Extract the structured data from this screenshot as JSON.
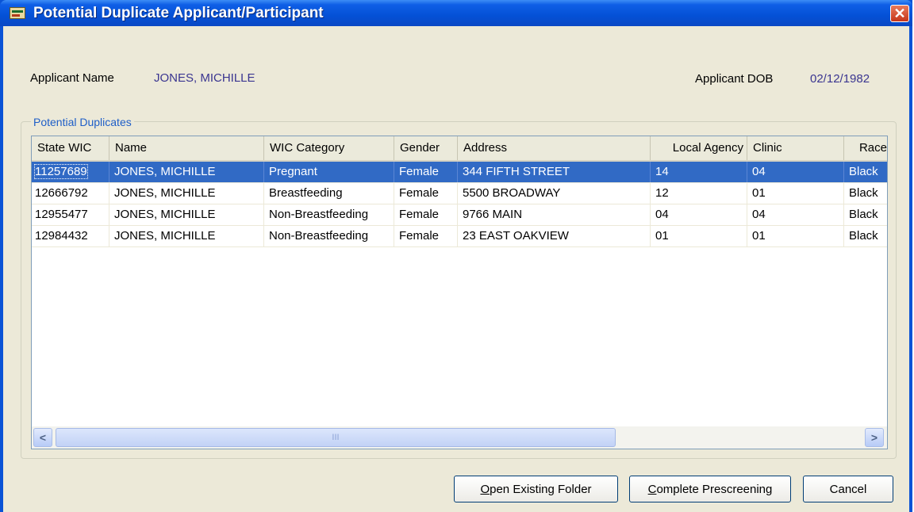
{
  "window": {
    "title": "Potential Duplicate Applicant/Participant",
    "close_glyph": "✕"
  },
  "applicant": {
    "name_label": "Applicant Name",
    "name_value": "JONES, MICHILLE",
    "dob_label": "Applicant DOB",
    "dob_value": "02/12/1982"
  },
  "duplicates": {
    "group_title": "Potential Duplicates",
    "columns": [
      "State WIC",
      "Name",
      "WIC Category",
      "Gender",
      "Address",
      "Local Agency",
      "Clinic",
      "Race"
    ],
    "rows": [
      [
        "11257689",
        "JONES, MICHILLE",
        "Pregnant",
        "Female",
        "344 FIFTH STREET",
        "14",
        "04",
        "Black"
      ],
      [
        "12666792",
        "JONES, MICHILLE",
        "Breastfeeding",
        "Female",
        "5500 BROADWAY",
        "12",
        "01",
        "Black"
      ],
      [
        "12955477",
        "JONES, MICHILLE",
        "Non-Breastfeeding",
        "Female",
        "9766 MAIN",
        "04",
        "04",
        "Black"
      ],
      [
        "12984432",
        "JONES, MICHILLE",
        "Non-Breastfeeding",
        "Female",
        "23 EAST OAKVIEW",
        "01",
        "01",
        "Black"
      ]
    ],
    "selected_row": 0,
    "scroll": {
      "left_glyph": "<",
      "right_glyph": ">",
      "thumb_grip": "III"
    }
  },
  "buttons": {
    "open": {
      "mnemonic": "O",
      "rest": "pen Existing Folder"
    },
    "complete": {
      "mnemonic": "C",
      "rest": "omplete Prescreening"
    },
    "cancel": "Cancel"
  },
  "colors": {
    "titlebar": "#0451d6",
    "selection": "#316ac5",
    "value_text": "#3a3590",
    "group_title": "#1e5ec8"
  }
}
